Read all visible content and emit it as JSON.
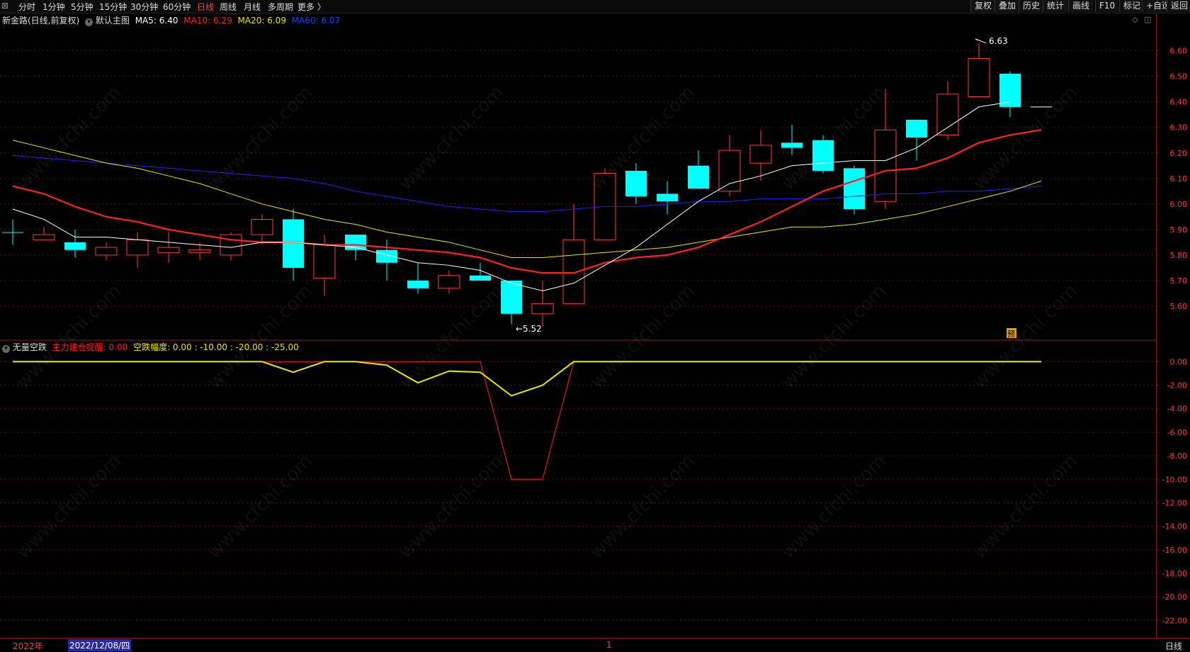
{
  "toolbar": {
    "periods": [
      "分时",
      "1分钟",
      "5分钟",
      "15分钟",
      "30分钟",
      "60分钟",
      "日线",
      "周线",
      "月线",
      "多周期",
      "更多 〉"
    ],
    "active_period": "日线",
    "right_items": [
      "复权",
      "叠加",
      "历史",
      "统计",
      "画线",
      "F10",
      "标记",
      "+自选",
      "返回"
    ]
  },
  "main": {
    "stock_title": "新金路(日线,前复权)",
    "template": "默认主图",
    "ma5_label": "MA5: 6.40",
    "ma10_label": "MA10: 6.29",
    "ma20_label": "MA20: 6.09",
    "ma60_label": "MA60: 6.07",
    "high_label": "6.63",
    "low_label": "5.52",
    "forecast_badge": "预"
  },
  "indicator": {
    "name": "无量空跌",
    "line1_label": "主力建仓提醒: 0.00",
    "line2_label": "空跌幅度: 0.00 : -10.00 : -20.00 : -25.00"
  },
  "bottom": {
    "year_label": "2022年",
    "date_label": "2022/12/08/四",
    "month_marker": "1",
    "period_label": "日线"
  },
  "watermark": "www.cfchi.com",
  "colors": {
    "up": "#ff3b3b",
    "down": "#00ffff",
    "ma5": "#ffffff",
    "ma10": "#ff2020",
    "ma20": "#e8e800",
    "ma60": "#2020ff"
  },
  "chart_data": [
    {
      "type": "candlestick",
      "ylim": [
        5.5,
        6.66
      ],
      "y_ticks": [
        "6.60",
        "6.50",
        "6.40",
        "6.30",
        "6.20",
        "6.10",
        "6.00",
        "5.90",
        "5.80",
        "5.70",
        "5.60"
      ],
      "candles": [
        {
          "o": 5.89,
          "c": 5.89,
          "h": 5.94,
          "l": 5.84,
          "dir": "down"
        },
        {
          "o": 5.86,
          "c": 5.88,
          "h": 5.91,
          "l": 5.86,
          "dir": "up"
        },
        {
          "o": 5.85,
          "c": 5.82,
          "h": 5.9,
          "l": 5.79,
          "dir": "down"
        },
        {
          "o": 5.8,
          "c": 5.83,
          "h": 5.85,
          "l": 5.78,
          "dir": "up"
        },
        {
          "o": 5.8,
          "c": 5.86,
          "h": 5.89,
          "l": 5.75,
          "dir": "up"
        },
        {
          "o": 5.81,
          "c": 5.83,
          "h": 5.89,
          "l": 5.77,
          "dir": "up"
        },
        {
          "o": 5.81,
          "c": 5.82,
          "h": 5.85,
          "l": 5.78,
          "dir": "up"
        },
        {
          "o": 5.8,
          "c": 5.88,
          "h": 5.89,
          "l": 5.78,
          "dir": "up"
        },
        {
          "o": 5.88,
          "c": 5.94,
          "h": 5.96,
          "l": 5.84,
          "dir": "up"
        },
        {
          "o": 5.94,
          "c": 5.75,
          "h": 5.98,
          "l": 5.7,
          "dir": "down"
        },
        {
          "o": 5.71,
          "c": 5.84,
          "h": 5.88,
          "l": 5.64,
          "dir": "up"
        },
        {
          "o": 5.88,
          "c": 5.82,
          "h": 5.88,
          "l": 5.78,
          "dir": "down"
        },
        {
          "o": 5.82,
          "c": 5.77,
          "h": 5.86,
          "l": 5.7,
          "dir": "down"
        },
        {
          "o": 5.7,
          "c": 5.67,
          "h": 5.77,
          "l": 5.65,
          "dir": "down"
        },
        {
          "o": 5.67,
          "c": 5.72,
          "h": 5.74,
          "l": 5.65,
          "dir": "up"
        },
        {
          "o": 5.72,
          "c": 5.7,
          "h": 5.77,
          "l": 5.7,
          "dir": "down"
        },
        {
          "o": 5.7,
          "c": 5.57,
          "h": 5.7,
          "l": 5.53,
          "dir": "down"
        },
        {
          "o": 5.57,
          "c": 5.61,
          "h": 5.7,
          "l": 5.52,
          "dir": "up"
        },
        {
          "o": 5.61,
          "c": 5.86,
          "h": 6.0,
          "l": 5.61,
          "dir": "up"
        },
        {
          "o": 5.86,
          "c": 6.12,
          "h": 6.14,
          "l": 5.86,
          "dir": "up"
        },
        {
          "o": 6.13,
          "c": 6.03,
          "h": 6.16,
          "l": 6.0,
          "dir": "down"
        },
        {
          "o": 6.04,
          "c": 6.01,
          "h": 6.09,
          "l": 5.96,
          "dir": "down"
        },
        {
          "o": 6.15,
          "c": 6.06,
          "h": 6.21,
          "l": 6.06,
          "dir": "down"
        },
        {
          "o": 6.05,
          "c": 6.21,
          "h": 6.27,
          "l": 6.03,
          "dir": "up"
        },
        {
          "o": 6.16,
          "c": 6.23,
          "h": 6.29,
          "l": 6.09,
          "dir": "up"
        },
        {
          "o": 6.24,
          "c": 6.22,
          "h": 6.31,
          "l": 6.19,
          "dir": "down"
        },
        {
          "o": 6.25,
          "c": 6.13,
          "h": 6.27,
          "l": 6.12,
          "dir": "down"
        },
        {
          "o": 6.14,
          "c": 5.98,
          "h": 6.15,
          "l": 5.96,
          "dir": "down"
        },
        {
          "o": 6.01,
          "c": 6.29,
          "h": 6.45,
          "l": 5.98,
          "dir": "up"
        },
        {
          "o": 6.33,
          "c": 6.26,
          "h": 6.33,
          "l": 6.17,
          "dir": "down"
        },
        {
          "o": 6.27,
          "c": 6.43,
          "h": 6.48,
          "l": 6.25,
          "dir": "up"
        },
        {
          "o": 6.42,
          "c": 6.57,
          "h": 6.63,
          "l": 6.42,
          "dir": "up"
        },
        {
          "o": 6.51,
          "c": 6.38,
          "h": 6.52,
          "l": 6.34,
          "dir": "down"
        },
        {
          "o": 6.38,
          "c": 6.38,
          "h": 6.38,
          "l": 6.38,
          "dir": "flat"
        }
      ],
      "ma5": [
        5.98,
        5.94,
        5.87,
        5.87,
        5.86,
        5.85,
        5.84,
        5.83,
        5.85,
        5.85,
        5.84,
        5.83,
        5.8,
        5.77,
        5.76,
        5.74,
        5.69,
        5.66,
        5.69,
        5.76,
        5.83,
        5.92,
        6.01,
        6.08,
        6.11,
        6.15,
        6.16,
        6.17,
        6.17,
        6.22,
        6.3,
        6.38,
        6.4
      ],
      "ma10": [
        6.07,
        6.04,
        5.99,
        5.95,
        5.93,
        5.9,
        5.88,
        5.86,
        5.85,
        5.85,
        5.84,
        5.84,
        5.83,
        5.82,
        5.81,
        5.79,
        5.75,
        5.73,
        5.73,
        5.77,
        5.79,
        5.8,
        5.83,
        5.88,
        5.93,
        5.99,
        6.05,
        6.09,
        6.13,
        6.14,
        6.18,
        6.24,
        6.27,
        6.29
      ],
      "ma20": [
        6.25,
        6.22,
        6.19,
        6.16,
        6.14,
        6.11,
        6.08,
        6.04,
        6.0,
        5.97,
        5.94,
        5.92,
        5.89,
        5.87,
        5.85,
        5.82,
        5.79,
        5.79,
        5.8,
        5.81,
        5.82,
        5.83,
        5.85,
        5.87,
        5.89,
        5.91,
        5.91,
        5.92,
        5.94,
        5.96,
        5.99,
        6.02,
        6.05,
        6.09
      ],
      "ma60": [
        6.19,
        6.18,
        6.17,
        6.16,
        6.15,
        6.14,
        6.13,
        6.12,
        6.11,
        6.1,
        6.08,
        6.05,
        6.03,
        6.01,
        5.99,
        5.98,
        5.97,
        5.97,
        5.98,
        5.99,
        5.99,
        6.0,
        6.01,
        6.01,
        6.02,
        6.02,
        6.02,
        6.03,
        6.04,
        6.04,
        6.05,
        6.05,
        6.06,
        6.07
      ]
    },
    {
      "type": "line",
      "ylim": [
        -23.0,
        0.5
      ],
      "y_ticks": [
        "0.00",
        "-2.00",
        "-4.00",
        "-6.00",
        "-8.00",
        "-10.00",
        "-12.00",
        "-14.00",
        "-16.00",
        "-18.00",
        "-20.00",
        "-22.00"
      ],
      "series": [
        {
          "name": "主力建仓提醒",
          "color": "#ff2020",
          "values": [
            0,
            0,
            0,
            0,
            0,
            0,
            0,
            0,
            0,
            0,
            0,
            0,
            0,
            0,
            0,
            0,
            -10,
            -10,
            0,
            0,
            0,
            0,
            0,
            0,
            0,
            0,
            0,
            0,
            0,
            0,
            0,
            0,
            0,
            0
          ]
        },
        {
          "name": "空跌幅度",
          "color": "#e8e800",
          "values": [
            0,
            0,
            0,
            0,
            0,
            0,
            0,
            0,
            0,
            -0.9,
            0,
            0,
            -0.3,
            -1.8,
            -0.8,
            -0.9,
            -2.9,
            -2.0,
            0,
            0,
            0,
            0,
            0,
            0,
            0,
            0,
            0,
            0,
            0,
            0,
            0,
            0,
            0,
            0
          ]
        }
      ]
    }
  ]
}
